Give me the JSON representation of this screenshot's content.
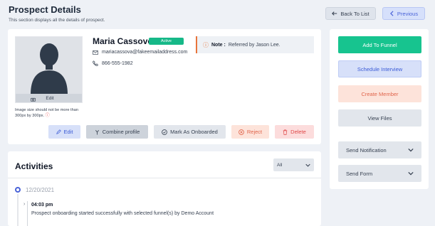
{
  "header": {
    "title": "Prospect Details",
    "subtitle": "This section displays all the details of prospect.",
    "back_label": "Back To List",
    "previous_label": "Previous"
  },
  "profile": {
    "photo_edit_label": "Edit",
    "photo_note": "Image size should not be more than 300px by 300px.",
    "name": "Maria Cassovo",
    "status": "Active",
    "email": "mariacassova@fakeemailaddress.com",
    "phone": "866-555-1982",
    "note_label": "Note :",
    "note_text": "Referred by Jason Lee."
  },
  "actions": {
    "edit": "Edit",
    "combine": "Combine profile",
    "onboard": "Mark As Onboarded",
    "reject": "Reject",
    "delete": "Delete"
  },
  "side": {
    "add_funnel": "Add To Funnel",
    "schedule_interview": "Schedule Interview",
    "create_member": "Create Member",
    "view_files": "View Files",
    "send_notification": "Send Notification",
    "send_form": "Send Form"
  },
  "activities": {
    "title": "Activities",
    "filter_value": "All",
    "date": "12/20/2021",
    "entries": [
      {
        "time": "04:03 pm",
        "text": "Prospect onboarding started successfully with selected funnel(s) by Demo Account"
      }
    ]
  },
  "colors": {
    "primary": "#4a63d8",
    "success": "#16b888",
    "danger": "#e04a4a",
    "note_accent": "#e8743b"
  }
}
